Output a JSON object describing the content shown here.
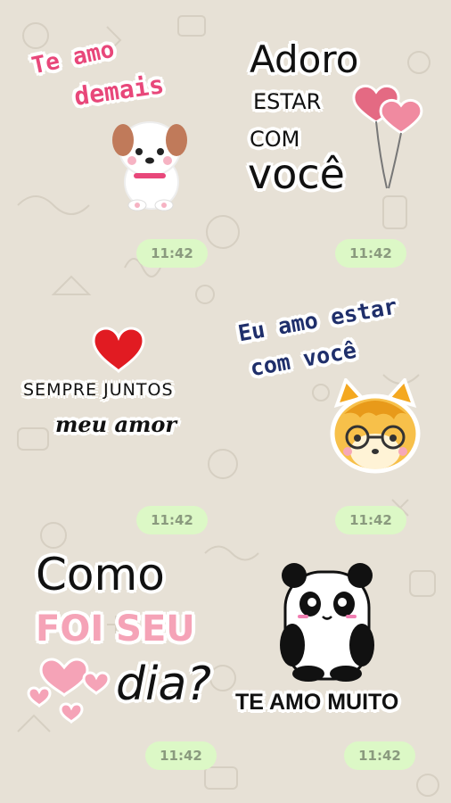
{
  "colors": {
    "background": "#e7e1d6",
    "bubble": "#dcf8c6",
    "timestamp_text": "#8a9a7e",
    "pink": "#e8477a",
    "navy": "#1f2f6b",
    "light_pink": "#f5a3b7"
  },
  "stickers": {
    "s1": {
      "line1": "Te amo",
      "line2": "demais",
      "time": "11:42",
      "icon": "puppy-icon"
    },
    "s2": {
      "line1": "Adoro",
      "line2": "ESTAR",
      "line3": "COM",
      "line4": "você",
      "time": "11:42",
      "icon": "heart-balloons-icon"
    },
    "s3": {
      "line1": "SEMPRE JUNTOS",
      "line2": "meu amor",
      "time": "11:42",
      "icon": "red-heart-icon"
    },
    "s4": {
      "line1": "Eu amo estar",
      "line2": "com você",
      "time": "11:42",
      "icon": "fox-icon"
    },
    "s5": {
      "line1": "Como",
      "line2": "FOI SEU",
      "line3": "dia?",
      "time": "11:42",
      "icon": "pink-hearts-icon"
    },
    "s6": {
      "line1": "TE AMO MUITO",
      "time": "11:42",
      "icon": "panda-icon"
    }
  }
}
